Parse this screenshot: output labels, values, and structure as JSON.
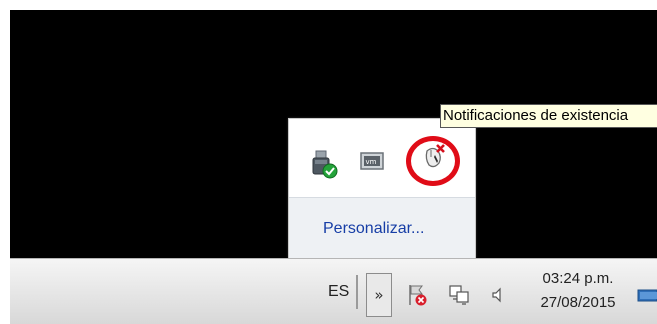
{
  "tooltip": {
    "text": "Notificaciones de existencia"
  },
  "popup": {
    "customize_label": "Personalizar...",
    "icons": [
      "usb-safely-remove-icon",
      "vmware-tools-icon",
      "mouse-notification-icon"
    ]
  },
  "taskbar": {
    "language": "ES",
    "show_hidden_glyph": "»",
    "tray_icons": [
      "action-center-flag-icon",
      "network-icon",
      "speaker-icon"
    ],
    "time": "03:24 p.m.",
    "date": "27/08/2015"
  },
  "colors": {
    "highlight_circle": "#e00c17",
    "link": "#173ea6",
    "tooltip_bg": "#ffffe1"
  }
}
